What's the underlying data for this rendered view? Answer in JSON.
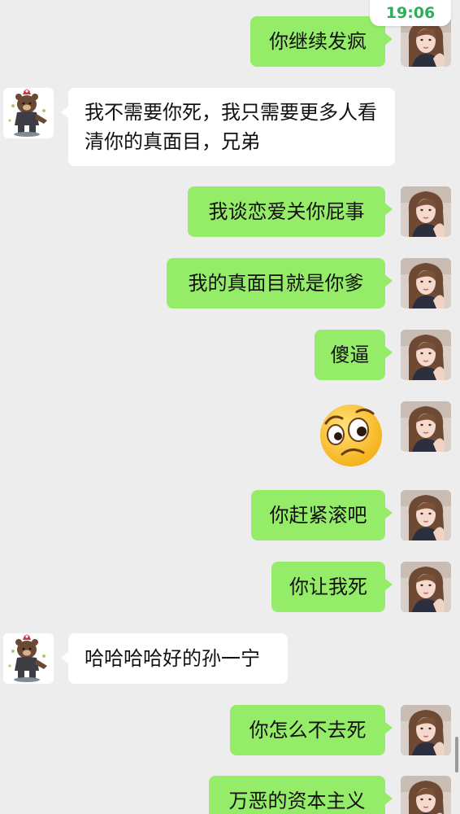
{
  "status_bar": {
    "time": "19:06"
  },
  "messages": [
    {
      "from": "self",
      "text": "你继续发疯"
    },
    {
      "from": "other",
      "text": "我不需要你死，我只需要更多人看清你的真面目，兄弟"
    },
    {
      "from": "self",
      "text": "我谈恋爱关你屁事"
    },
    {
      "from": "self",
      "text": "我的真面目就是你爹"
    },
    {
      "from": "self",
      "text": "傻逼"
    },
    {
      "from": "self",
      "sticker": "confused-frown-emoji"
    },
    {
      "from": "self",
      "text": "你赶紧滚吧"
    },
    {
      "from": "self",
      "text": "你让我死"
    },
    {
      "from": "other",
      "text": "哈哈哈哈好的孙一宁"
    },
    {
      "from": "self",
      "text": "你怎么不去死"
    },
    {
      "from": "self",
      "text": "万恶的资本主义"
    }
  ],
  "colors": {
    "background": "#ededed",
    "self_bubble": "#95ec69",
    "other_bubble": "#ffffff",
    "time_text": "#2fae5c"
  },
  "icons": {
    "self_avatar": "woman-avatar-icon",
    "other_avatar": "bear-cartoon-avatar-icon"
  }
}
